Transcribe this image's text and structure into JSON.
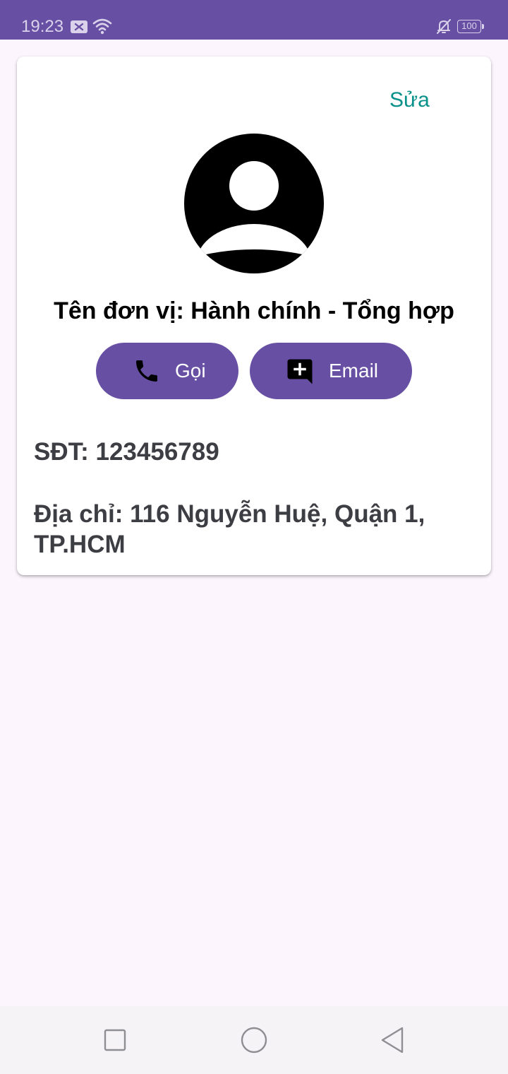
{
  "status_bar": {
    "time": "19:23",
    "battery": "100",
    "background": "#6750a4"
  },
  "contact": {
    "edit_label": "Sửa",
    "unit_name": "Tên đơn vị: Hành chính - Tổng hợp",
    "call_label": "Gọi",
    "email_label": "Email",
    "phone": "SĐT: 123456789",
    "address": "Địa chỉ: 116 Nguyễn Huệ, Quận 1, TP.HCM"
  },
  "colors": {
    "accent": "#6750a4",
    "edit_link": "#08918a",
    "page_background": "#fcf5fd"
  },
  "icons": {
    "status": [
      "message-notification-icon",
      "wifi-icon",
      "notifications-off-icon",
      "battery-icon"
    ],
    "avatar": "account-circle-icon",
    "call": "phone-icon",
    "email": "add-comment-icon",
    "navigation": [
      "recent-apps-icon",
      "home-icon",
      "back-icon"
    ]
  }
}
